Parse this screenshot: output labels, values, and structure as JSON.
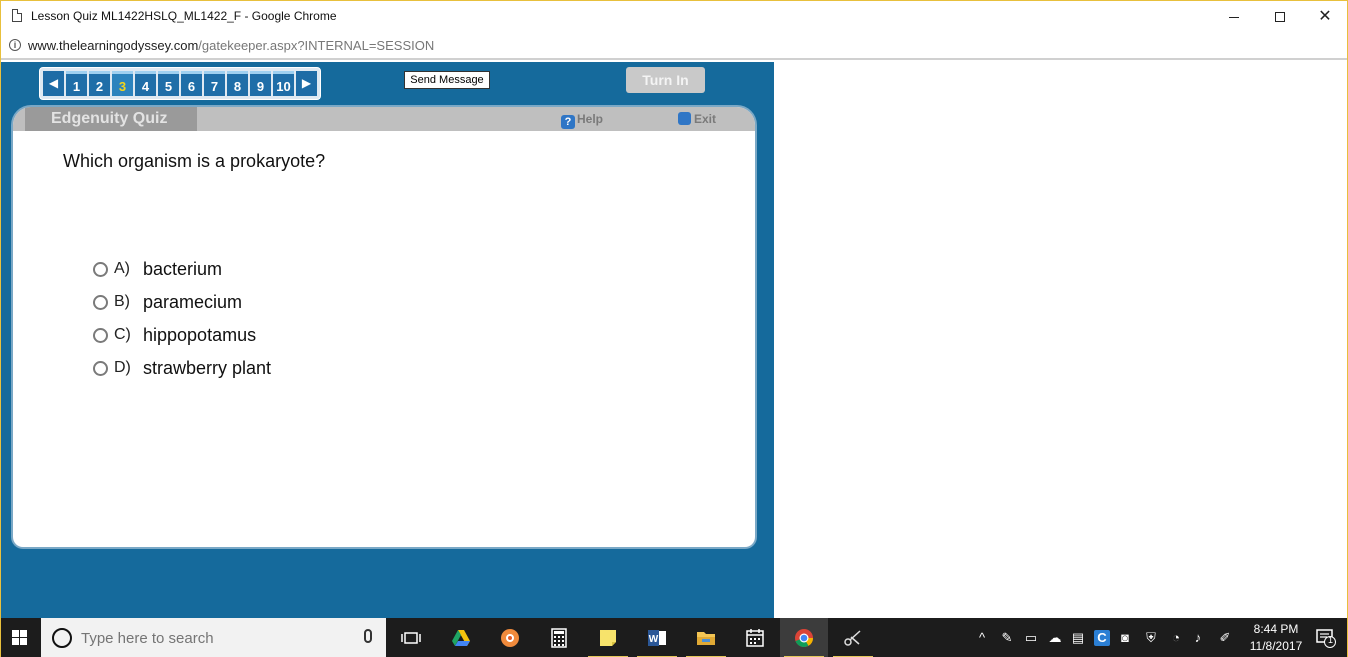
{
  "browser": {
    "title": "Lesson Quiz ML1422HSLQ_ML1422_F - Google Chrome",
    "url_host": "www.thelearningodyssey.com",
    "url_path": "/gatekeeper.aspx?INTERNAL=SESSION",
    "controls": {
      "minimize": "—",
      "maximize": "",
      "close": "✕"
    }
  },
  "quiz_nav": {
    "prev": "◀",
    "next": "▶",
    "questions": [
      "1",
      "2",
      "3",
      "4",
      "5",
      "6",
      "7",
      "8",
      "9",
      "10"
    ],
    "current": "3"
  },
  "toolbar": {
    "send_message": "Send Message",
    "turn_in": "Turn In"
  },
  "card": {
    "brand": "Edgenuity Quiz",
    "help": "Help",
    "help_icon": "?",
    "exit": "Exit"
  },
  "question": {
    "text": "Which organism is a prokaryote?",
    "options": [
      {
        "letter": "A)",
        "text": "bacterium"
      },
      {
        "letter": "B)",
        "text": "paramecium"
      },
      {
        "letter": "C)",
        "text": "hippopotamus"
      },
      {
        "letter": "D)",
        "text": "strawberry plant"
      }
    ]
  },
  "taskbar": {
    "search_placeholder": "Type here to search",
    "clock_time": "8:44 PM",
    "clock_date": "11/8/2017",
    "notification_count": "1",
    "apps": [
      "task-view",
      "google-drive",
      "pinwheel-app",
      "calculator",
      "sticky-notes",
      "word",
      "file-explorer",
      "calendar",
      "chrome",
      "snipping-tool"
    ]
  },
  "colors": {
    "app_bg": "#156a9c",
    "nav_button": "#1f6ea8",
    "current_question": "#f3d51a",
    "taskbar": "#1c1c1c"
  }
}
